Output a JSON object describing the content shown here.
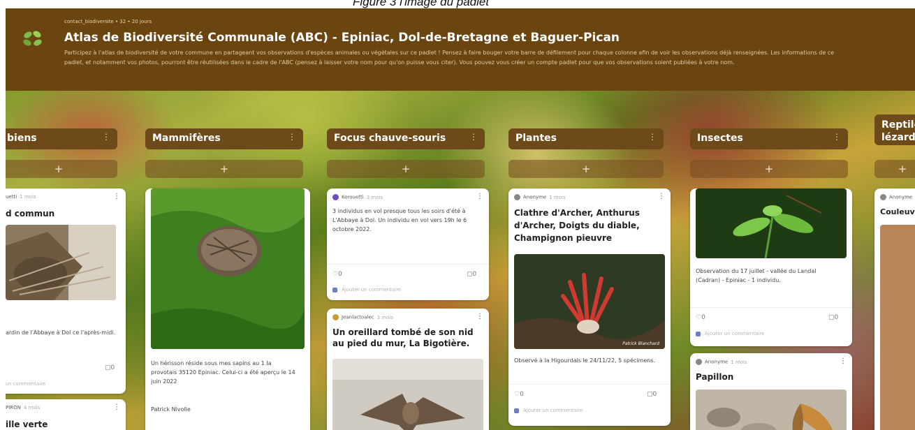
{
  "caption": "Figure 3 l'image du padlet",
  "header": {
    "meta": "contact_biodiversite • 32 • 20 jours",
    "title": "Atlas de Biodiversité Communale (ABC) - Epiniac, Dol-de-Bretagne et Baguer-Pican",
    "description": "Participez à l'atlas de biodiversité de votre commune en partageant vos observations d'espèces animales ou végétales sur ce padlet ! Pensez à faire bouger votre barre de défilement pour chaque colonne afin de voir les observations déjà renseignées. Les informations de ce padlet, et notamment vos photos, pourront être réutilisées dans le cadre de l'ABC (pensez à laisser votre nom pour qu'on puisse vous citer). Vous pouvez vous créer un compte padlet pour que vos observations soient publiées à votre nom."
  },
  "columns": [
    {
      "title": "biens"
    },
    {
      "title": "Mammifères"
    },
    {
      "title": "Focus chauve-souris"
    },
    {
      "title": "Plantes"
    },
    {
      "title": "Insectes"
    },
    {
      "title": "Reptiles lézards"
    }
  ],
  "add_label": "+",
  "kebab": "⋮",
  "heart": "♡0",
  "comment": "▢0",
  "add_comment": "Ajouter un commentaire",
  "cards": {
    "amphibiens_1": {
      "author": "uetti",
      "time": "1 mois",
      "title": "d commun",
      "text": "ardin de l'Abbaye à Dol ce l'après-midi."
    },
    "amphibiens_2": {
      "author": "PIRON",
      "time": "4 mois",
      "title": "ille verte"
    },
    "mammiferes_1": {
      "text": "Un hérisson réside sous mes sapins au 1 la provotais 35120 Epiniac. Celui-ci a été aperçu le 14 juin 2022",
      "signature": "Patrick Nivolle"
    },
    "chauve_1": {
      "author": "Kerouetti",
      "time": "3 mois",
      "text": "3 individus en vol presque tous les soirs d'été à L'Abbaye à Dol. Un individu en vol vers 19h le 6 octobre 2022."
    },
    "chauve_2": {
      "author": "Jeanlactoalec",
      "time": "3 mois",
      "title": "Un oreillard tombé de son nid au pied du mur, La Bigotière."
    },
    "plantes_1": {
      "author": "Anonyme",
      "time": "1 mois",
      "title": "Clathre d'Archer, Anthurus d'Archer, Doigts du diable, Champignon pieuvre",
      "img_credit": "Patrick Blanchard",
      "text": "Observé à la Higourdais le 24/11/22, 5 spécimens."
    },
    "insectes_1": {
      "text": "Observation du 17 juillet - vallée du Landal (Cadran) - Epiniac - 1 individu."
    },
    "insectes_2": {
      "author": "Anonyme",
      "time": "1 mois",
      "title": "Papillon"
    },
    "reptiles_1": {
      "author": "Anonyme",
      "title": "Couleuvre"
    }
  }
}
